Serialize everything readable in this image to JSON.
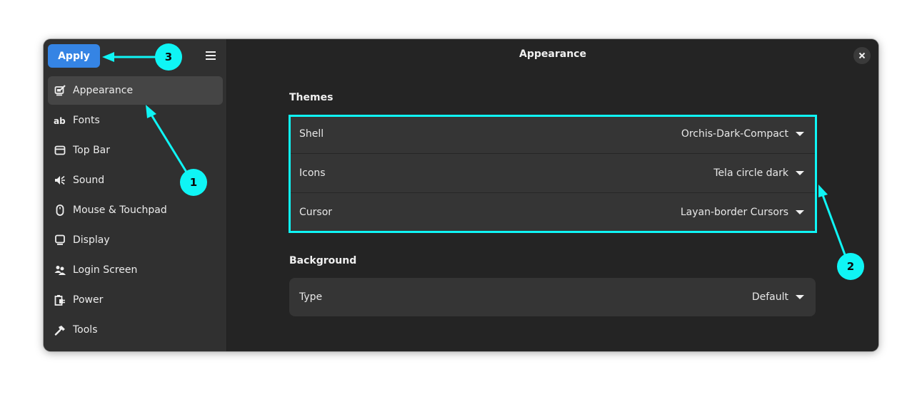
{
  "sidebar": {
    "apply_label": "Apply",
    "menu_icon": "hamburger-menu-icon",
    "items": [
      {
        "label": "Appearance",
        "icon": "appearance-icon",
        "active": true
      },
      {
        "label": "Fonts",
        "icon": "fonts-icon",
        "active": false
      },
      {
        "label": "Top Bar",
        "icon": "top-bar-icon",
        "active": false
      },
      {
        "label": "Sound",
        "icon": "sound-icon",
        "active": false
      },
      {
        "label": "Mouse & Touchpad",
        "icon": "mouse-icon",
        "active": false
      },
      {
        "label": "Display",
        "icon": "display-icon",
        "active": false
      },
      {
        "label": "Login Screen",
        "icon": "login-screen-icon",
        "active": false
      },
      {
        "label": "Power",
        "icon": "power-icon",
        "active": false
      },
      {
        "label": "Tools",
        "icon": "tools-icon",
        "active": false
      }
    ]
  },
  "content": {
    "title": "Appearance",
    "themes": {
      "heading": "Themes",
      "rows": [
        {
          "label": "Shell",
          "value": "Orchis-Dark-Compact"
        },
        {
          "label": "Icons",
          "value": "Tela circle dark"
        },
        {
          "label": "Cursor",
          "value": "Layan-border Cursors"
        }
      ]
    },
    "background": {
      "heading": "Background",
      "rows": [
        {
          "label": "Type",
          "value": "Default"
        }
      ]
    }
  },
  "annotations": {
    "color": "#0ff5f5",
    "badges": [
      "1",
      "2",
      "3"
    ]
  },
  "colors": {
    "accent": "#3584e4",
    "annotation": "#0ff5f5"
  }
}
